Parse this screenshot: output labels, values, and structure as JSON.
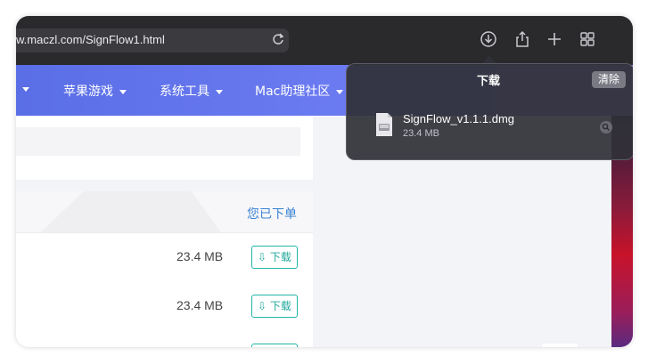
{
  "browser": {
    "url": "w.maczl.com/SignFlow1.html"
  },
  "nav": {
    "items": [
      {
        "label": "苹果游戏"
      },
      {
        "label": "系统工具"
      },
      {
        "label": "Mac助理社区"
      }
    ]
  },
  "content": {
    "ordered_label": "您已下单",
    "rows": [
      {
        "size": "23.4 MB",
        "button": "下载"
      },
      {
        "size": "23.4 MB",
        "button": "下载"
      }
    ]
  },
  "downloads": {
    "title": "下载",
    "clear_label": "清除",
    "file_name": "SignFlow_v1.1.1.dmg",
    "file_size": "23.4 MB"
  },
  "colors": {
    "nav_start": "#5a6ee6",
    "nav_end": "#8a7cf2",
    "accent_teal": "#21b5a8",
    "link_blue": "#3a82d6"
  }
}
